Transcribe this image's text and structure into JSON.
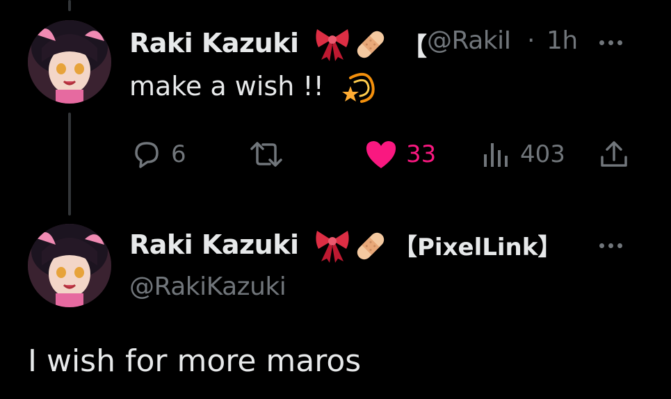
{
  "tweet1": {
    "display_name": "Raki Kazuki",
    "name_suffix": "【",
    "handle": "@RakiI",
    "separator": "·",
    "time": "1h",
    "text": "make a wish !!",
    "text_emoji": "dizzy-icon",
    "actions": {
      "replies": "6",
      "reposts": "",
      "likes": "33",
      "views": "403"
    },
    "like_color": "#f91880"
  },
  "tweet2": {
    "display_name": "Raki Kazuki",
    "name_suffix": "【PixelLink】",
    "handle": "@RakiKazuki",
    "text": "I wish for more maros"
  },
  "colors": {
    "background": "#000000",
    "text": "#e7e9ea",
    "secondary": "#71767b",
    "like": "#f91880"
  }
}
